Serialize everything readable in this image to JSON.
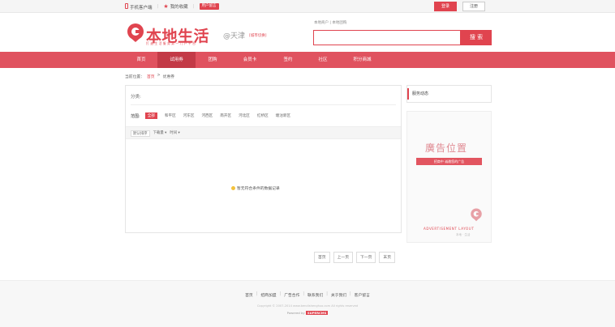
{
  "topbar": {
    "mobile_label": "手机客户端",
    "fav_label": "我的收藏",
    "badge": "用户留言",
    "login": "登录",
    "register": "注册"
  },
  "header": {
    "logo_text": "本地生活",
    "slogan": "打造生活服务第一门户平台",
    "city": "@天津",
    "city_switch": "[城市切换]",
    "hot_links": "本地商户  |  本地团购",
    "search_placeholder": "",
    "search_button": "搜 索"
  },
  "nav": {
    "items": [
      {
        "label": "首页",
        "active": false
      },
      {
        "label": "试用券",
        "active": true
      },
      {
        "label": "团购",
        "active": false
      },
      {
        "label": "会员卡",
        "active": false
      },
      {
        "label": "签约",
        "active": false
      },
      {
        "label": "社区",
        "active": false
      },
      {
        "label": "积分商城",
        "active": false
      }
    ]
  },
  "breadcrumb": {
    "prefix": "当前位置：",
    "home": "首页",
    "sep": ">",
    "current": "优惠券"
  },
  "filter": {
    "class_label": "分类:",
    "range_label": "范围:",
    "range_options": [
      "全部",
      "和平区",
      "河东区",
      "河西区",
      "南开区",
      "河北区",
      "红桥区",
      "塘沽新区"
    ],
    "range_selected": 0
  },
  "sort": {
    "items": [
      "默认排序",
      "下载量 ▾",
      "时间 ▾"
    ]
  },
  "empty_message": "暂无符合条件的数据记录",
  "side": {
    "title": "服务动态",
    "ad_title": "廣告位置",
    "ad_sub": "招商中 诚邀您的广告",
    "ad_en": "ADVERTISEMENT LAYOUT",
    "ad_en2": "本地 · 生活"
  },
  "pager": [
    "首页",
    "上一页",
    "下一页",
    "末页"
  ],
  "footer": {
    "links": [
      "首页",
      "招商加盟",
      "广告合作",
      "联系我们",
      "关于我们",
      "客户留言"
    ],
    "copyright": "Copyright © 2007-2014 www.bendishenghuo.com All rights reserved",
    "powered_prefix": "Powered by ",
    "powered_brand": "SUPERCMS"
  },
  "colors": {
    "accent": "#e0444f",
    "nav": "#e0525f",
    "nav_active": "#c33a47"
  }
}
